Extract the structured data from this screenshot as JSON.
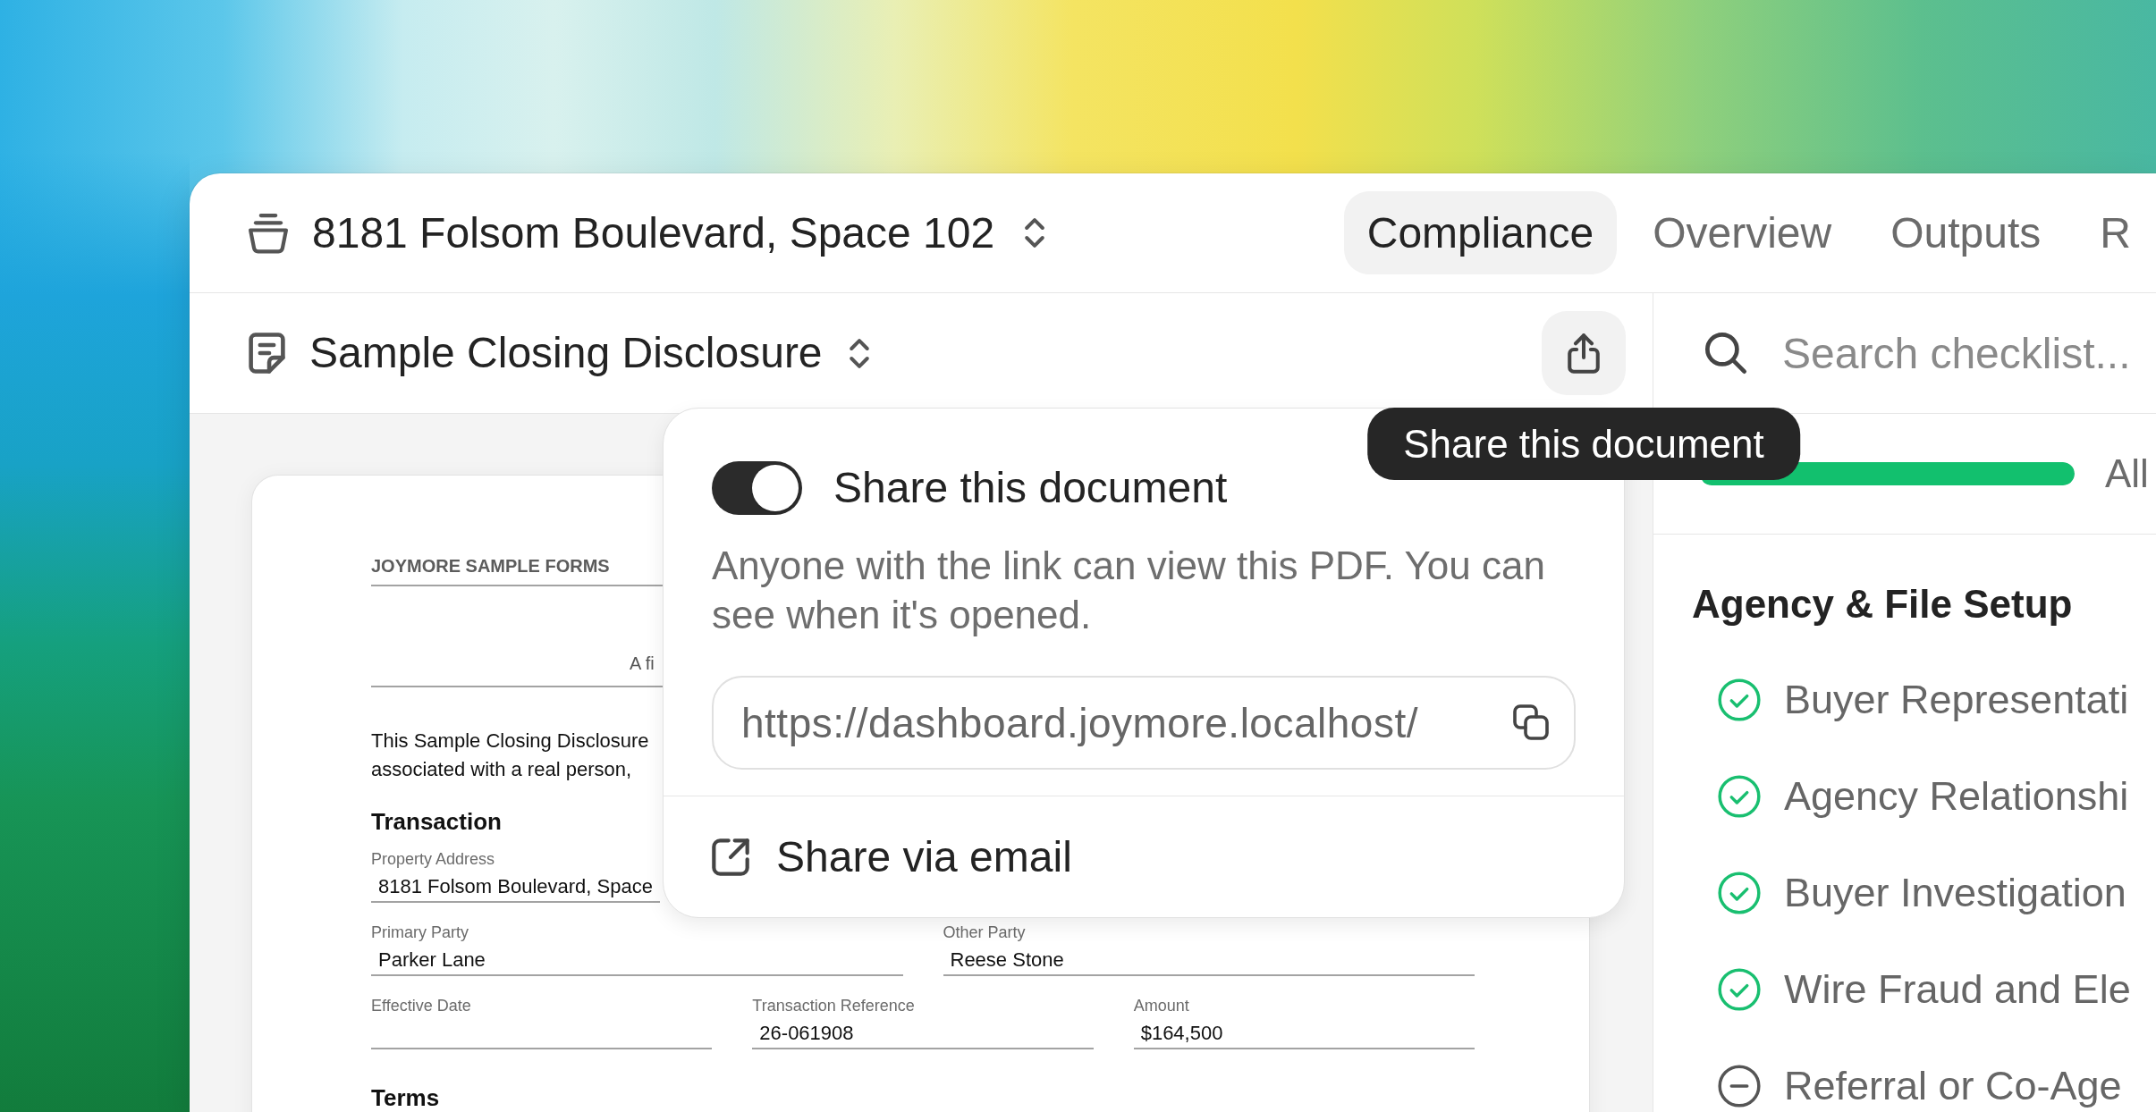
{
  "header": {
    "project_title": "8181 Folsom Boulevard, Space 102",
    "tabs": [
      {
        "label": "Compliance",
        "selected": true
      },
      {
        "label": "Overview",
        "selected": false
      },
      {
        "label": "Outputs",
        "selected": false
      },
      {
        "label": "R",
        "selected": false
      }
    ]
  },
  "document_bar": {
    "title": "Sample Closing Disclosure",
    "tooltip": "Share this document"
  },
  "share_popover": {
    "toggle": {
      "label": "Share this document",
      "on": true
    },
    "description": "Anyone with the link can view this PDF. You can see when it's opened.",
    "link": {
      "value": "https://dashboard.joymore.localhost/"
    },
    "email_action": {
      "label": "Share via email"
    }
  },
  "document": {
    "brand": "JOYMORE SAMPLE FORMS",
    "subtitle": "A fi",
    "intro_lines": [
      "This Sample Closing Disclosure",
      "associated with a real person,"
    ],
    "sections": [
      {
        "heading": "Transaction",
        "rows": [
          [
            {
              "label": "Property Address",
              "value": "8181 Folsom Boulevard, Space"
            }
          ],
          [
            {
              "label": "Primary Party",
              "value": "Parker Lane"
            },
            {
              "label": "Other Party",
              "value": "Reese Stone"
            }
          ],
          [
            {
              "label": "Effective Date"
            },
            {
              "label": "Transaction Reference",
              "value": "26-061908"
            },
            {
              "label": "Amount",
              "value": "$164,500"
            }
          ]
        ]
      },
      {
        "heading": "Terms"
      }
    ]
  },
  "checklist": {
    "search": {
      "placeholder": "Search checklist..."
    },
    "progress": {
      "level": 1,
      "label": "All"
    },
    "groups": [
      {
        "title": "Agency & File Setup",
        "items": [
          {
            "label": "Buyer Representati",
            "kind": "complete"
          },
          {
            "label": "Agency Relationshi",
            "kind": "complete"
          },
          {
            "label": "Buyer Investigation",
            "kind": "complete"
          },
          {
            "label": "Wire Fraud and Ele",
            "kind": "complete"
          },
          {
            "label": "Referral or Co-Age",
            "kind": "skipped"
          }
        ]
      }
    ]
  }
}
